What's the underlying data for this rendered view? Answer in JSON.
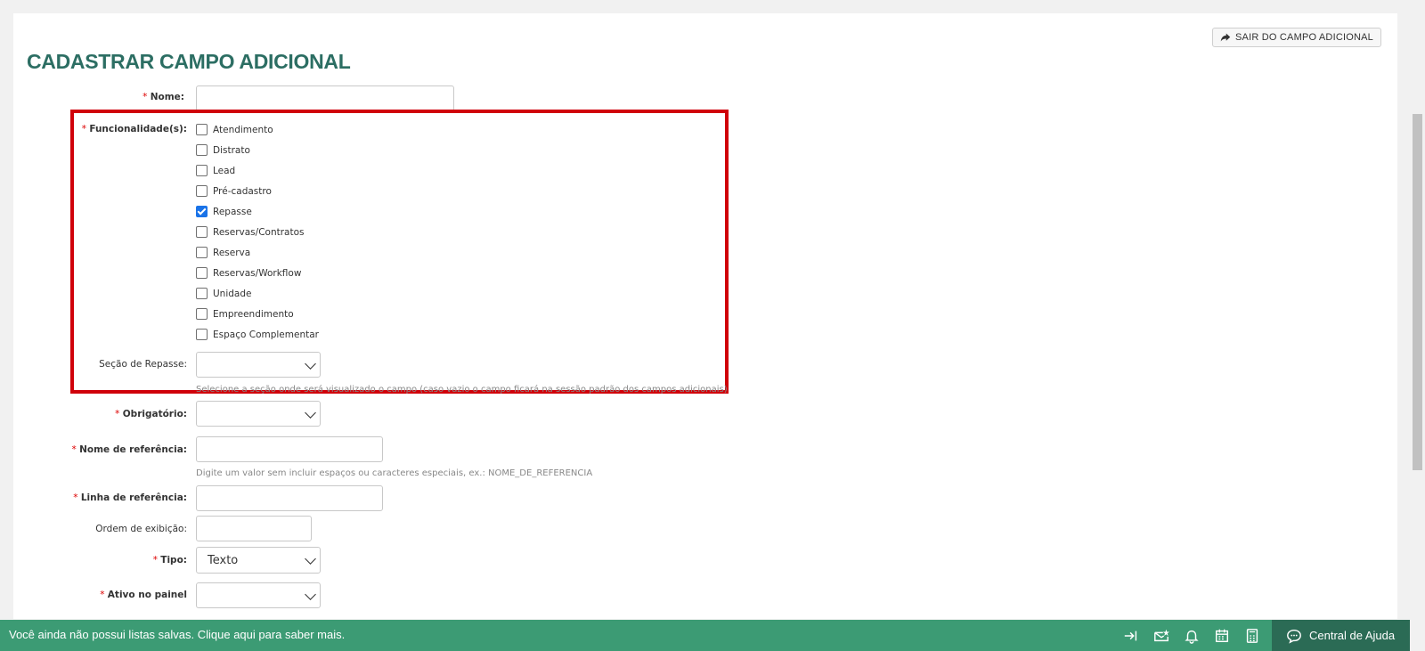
{
  "exit_button": {
    "label": "SAIR DO CAMPO ADICIONAL",
    "icon": "share-arrow-icon"
  },
  "page_title": "CADASTRAR CAMPO ADICIONAL",
  "form": {
    "nome": {
      "label": "Nome:",
      "required": true,
      "value": ""
    },
    "funcionalidades": {
      "label": "Funcionalidade(s):",
      "required": true,
      "options": [
        {
          "label": "Atendimento",
          "checked": false
        },
        {
          "label": "Distrato",
          "checked": false
        },
        {
          "label": "Lead",
          "checked": false
        },
        {
          "label": "Pré-cadastro",
          "checked": false
        },
        {
          "label": "Repasse",
          "checked": true
        },
        {
          "label": "Reservas/Contratos",
          "checked": false
        },
        {
          "label": "Reserva",
          "checked": false
        },
        {
          "label": "Reservas/Workflow",
          "checked": false
        },
        {
          "label": "Unidade",
          "checked": false
        },
        {
          "label": "Empreendimento",
          "checked": false
        },
        {
          "label": "Espaço Complementar",
          "checked": false
        }
      ]
    },
    "secao_repasse": {
      "label": "Seção de Repasse:",
      "value": "",
      "hint": "Selecione a seção onde será visualizado o campo (caso vazio o campo ficará na sessão padrão dos campos adicionais)"
    },
    "obrigatorio": {
      "label": "Obrigatório:",
      "required": true,
      "value": ""
    },
    "nome_referencia": {
      "label": "Nome de referência:",
      "required": true,
      "value": "",
      "hint": "Digite um valor sem incluir espaços ou caracteres especiais, ex.: NOME_DE_REFERENCIA"
    },
    "linha_referencia": {
      "label": "Linha de referência:",
      "required": true,
      "value": ""
    },
    "ordem_exibicao": {
      "label": "Ordem de exibição:",
      "value": ""
    },
    "tipo": {
      "label": "Tipo:",
      "required": true,
      "value": "Texto"
    },
    "ativo_painel": {
      "label": "Ativo no painel",
      "required": true,
      "value": ""
    }
  },
  "footer": {
    "message": "Você ainda não possui listas salvas. Clique aqui para saber mais.",
    "icons": [
      "collapse-right-icon",
      "mail-star-icon",
      "bell-icon",
      "calendar-icon",
      "calculator-icon"
    ],
    "help_label": "Central de Ajuda",
    "color": "#3c9b74",
    "help_color": "#2b6b55"
  },
  "colors": {
    "title": "#2c6e63",
    "highlight": "#d0000a",
    "checkbox_checked": "#1a73e8"
  }
}
